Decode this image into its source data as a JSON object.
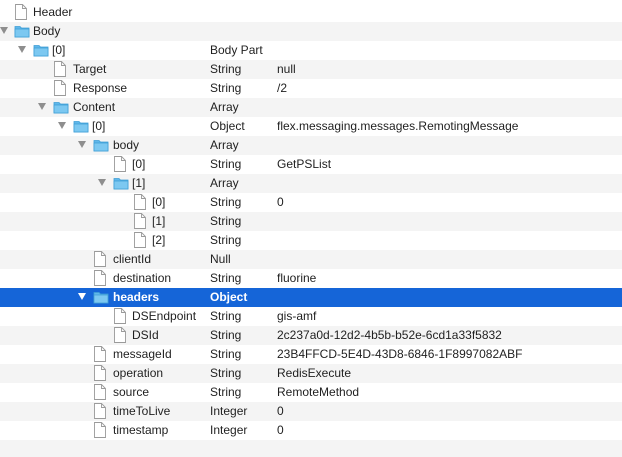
{
  "rows": [
    {
      "name": "Header",
      "type": "",
      "value": "",
      "icon": "document-icon"
    },
    {
      "name": "Body",
      "type": "",
      "value": "",
      "icon": "folder-icon"
    },
    {
      "name": "[0]",
      "type": "Body Part",
      "value": "",
      "icon": "folder-icon"
    },
    {
      "name": "Target",
      "type": "String",
      "value": "null",
      "icon": "document-icon"
    },
    {
      "name": "Response",
      "type": "String",
      "value": "/2",
      "icon": "document-icon"
    },
    {
      "name": "Content",
      "type": "Array",
      "value": "",
      "icon": "folder-icon"
    },
    {
      "name": "[0]",
      "type": "Object",
      "value": "flex.messaging.messages.RemotingMessage",
      "icon": "folder-icon"
    },
    {
      "name": "body",
      "type": "Array",
      "value": "",
      "icon": "folder-icon"
    },
    {
      "name": "[0]",
      "type": "String",
      "value": "GetPSList",
      "icon": "document-icon"
    },
    {
      "name": "[1]",
      "type": "Array",
      "value": "",
      "icon": "folder-icon"
    },
    {
      "name": "[0]",
      "type": "String",
      "value": "0",
      "icon": "document-icon"
    },
    {
      "name": "[1]",
      "type": "String",
      "value": "",
      "icon": "document-icon"
    },
    {
      "name": "[2]",
      "type": "String",
      "value": "",
      "icon": "document-icon"
    },
    {
      "name": "clientId",
      "type": "Null",
      "value": "",
      "icon": "document-icon"
    },
    {
      "name": "destination",
      "type": "String",
      "value": "fluorine",
      "icon": "document-icon"
    },
    {
      "name": "headers",
      "type": "Object",
      "value": "",
      "icon": "folder-icon"
    },
    {
      "name": "DSEndpoint",
      "type": "String",
      "value": "gis-amf",
      "icon": "document-icon"
    },
    {
      "name": "DSId",
      "type": "String",
      "value": "2c237a0d-12d2-4b5b-b52e-6cd1a33f5832",
      "icon": "document-icon"
    },
    {
      "name": "messageId",
      "type": "String",
      "value": "23B4FFCD-5E4D-43D8-6846-1F8997082ABF",
      "icon": "document-icon"
    },
    {
      "name": "operation",
      "type": "String",
      "value": "RedisExecute",
      "icon": "document-icon"
    },
    {
      "name": "source",
      "type": "String",
      "value": "RemoteMethod",
      "icon": "document-icon"
    },
    {
      "name": "timeToLive",
      "type": "Integer",
      "value": "0",
      "icon": "document-icon"
    },
    {
      "name": "timestamp",
      "type": "Integer",
      "value": "0",
      "icon": "document-icon"
    }
  ],
  "colors": {
    "selection": "#1565d8",
    "folder": "#5fb7ea",
    "alt_row": "#f4f4f4"
  }
}
